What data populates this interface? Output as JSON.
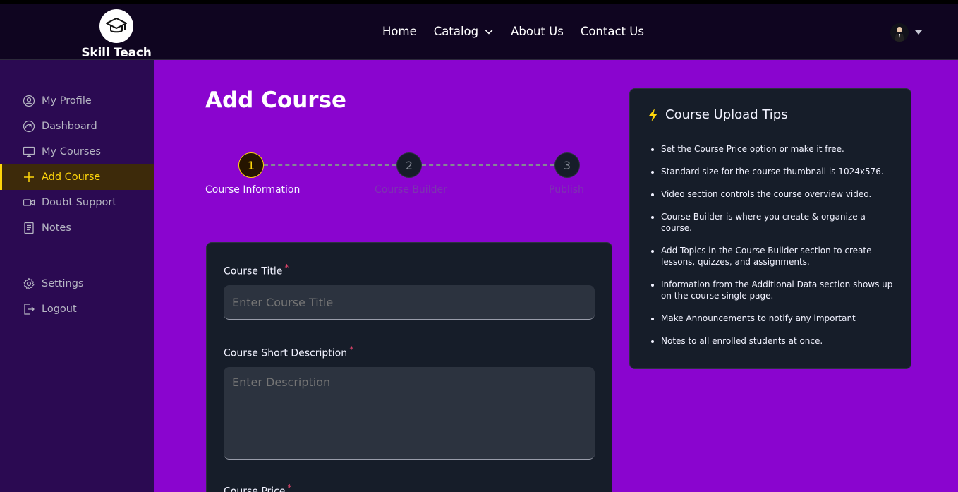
{
  "brand": {
    "name": "Skill Teach"
  },
  "nav": {
    "items": [
      {
        "label": "Home"
      },
      {
        "label": "Catalog"
      },
      {
        "label": "About Us"
      },
      {
        "label": "Contact Us"
      }
    ]
  },
  "sidebar": {
    "items": [
      {
        "label": "My Profile",
        "icon": "user-circle-icon"
      },
      {
        "label": "Dashboard",
        "icon": "dashboard-icon"
      },
      {
        "label": "My Courses",
        "icon": "monitor-icon"
      },
      {
        "label": "Add Course",
        "icon": "plus-icon",
        "active": true
      },
      {
        "label": "Doubt Support",
        "icon": "video-icon"
      },
      {
        "label": "Notes",
        "icon": "notes-icon"
      }
    ],
    "bottom_items": [
      {
        "label": "Settings",
        "icon": "gear-icon"
      },
      {
        "label": "Logout",
        "icon": "logout-icon"
      }
    ]
  },
  "main": {
    "title": "Add Course",
    "steps": [
      {
        "number": "1",
        "label": "Course Information",
        "active": true
      },
      {
        "number": "2",
        "label": "Course Builder",
        "active": false
      },
      {
        "number": "3",
        "label": "Publish",
        "active": false
      }
    ],
    "form": {
      "course_title": {
        "label": "Course Title",
        "required_mark": "*",
        "placeholder": "Enter Course Title",
        "value": ""
      },
      "short_description": {
        "label": "Course Short Description",
        "required_mark": "*",
        "placeholder": "Enter Description",
        "value": ""
      },
      "course_price": {
        "label": "Course Price",
        "required_mark": "*"
      }
    }
  },
  "tips": {
    "title": "Course Upload Tips",
    "icon": "lightning-icon",
    "items": [
      "Set the Course Price option or make it free.",
      "Standard size for the course thumbnail is 1024x576.",
      "Video section controls the course overview video.",
      "Course Builder is where you create & organize a course.",
      "Add Topics in the Course Builder section to create lessons, quizzes, and assignments.",
      "Information from the Additional Data section shows up on the course single page.",
      "Make Announcements to notify any important",
      "Notes to all enrolled students at once."
    ]
  },
  "colors": {
    "accent": "#ffd60a",
    "page_bg": "#8a05cf",
    "card_bg": "#161d29",
    "sidebar_bg": "#2b0a52",
    "required": "#ef476f"
  }
}
